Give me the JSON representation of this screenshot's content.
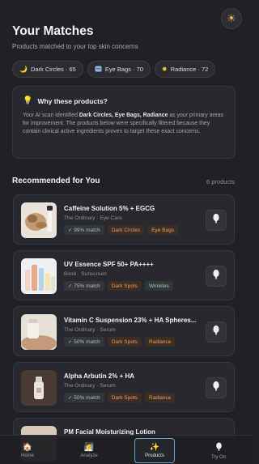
{
  "header": {
    "title": "Your Matches",
    "subtitle": "Products matched to your top skin concerns",
    "theme_icon": "sun-icon"
  },
  "concerns": [
    {
      "icon": "moon-icon",
      "label": "Dark Circles · 65"
    },
    {
      "icon": "eye-bags-icon",
      "label": "Eye Bags · 70"
    },
    {
      "icon": "sparkle-icon",
      "label": "Radiance · 72"
    }
  ],
  "why": {
    "heading": "Why these products?",
    "body_prefix": "Your AI scan identified ",
    "highlight": "Dark Circles, Eye Bags, Radiance",
    "body_suffix": " as your primary areas for improvement. The products below were specifically filtered because they contain clinical active ingredients proven to target these exact concerns."
  },
  "recommended": {
    "title": "Recommended for You",
    "count": "6 products"
  },
  "products": [
    {
      "name": "Caffeine Solution 5% + EGCG",
      "meta": "The Ordinary · Eye Care",
      "match": "✓ 99% match",
      "tags": [
        "Dark Circles",
        "Eye Bags"
      ]
    },
    {
      "name": "UV Essence SPF 50+ PA++++",
      "meta": "Bioré · Sunscreen",
      "match": "✓ 75% match",
      "tags": [
        "Dark Spots",
        "Wrinkles"
      ]
    },
    {
      "name": "Vitamin C Suspension 23% + HA Spheres...",
      "meta": "The Ordinary · Serum",
      "match": "✓ 50% match",
      "tags": [
        "Dark Spots",
        "Radiance"
      ]
    },
    {
      "name": "Alpha Arbutin 2% + HA",
      "meta": "The Ordinary · Serum",
      "match": "✓ 50% match",
      "tags": [
        "Dark Spots",
        "Radiance"
      ]
    },
    {
      "name": "PM Facial Moisturizing Lotion",
      "meta": "",
      "match": "",
      "tags": []
    }
  ],
  "tabs": [
    {
      "label": "Home",
      "icon": "home-icon"
    },
    {
      "label": "Analyze",
      "icon": "face-scan-icon"
    },
    {
      "label": "Products",
      "icon": "sparkles-icon",
      "active": true
    },
    {
      "label": "Try On",
      "icon": "mirror-icon"
    }
  ]
}
